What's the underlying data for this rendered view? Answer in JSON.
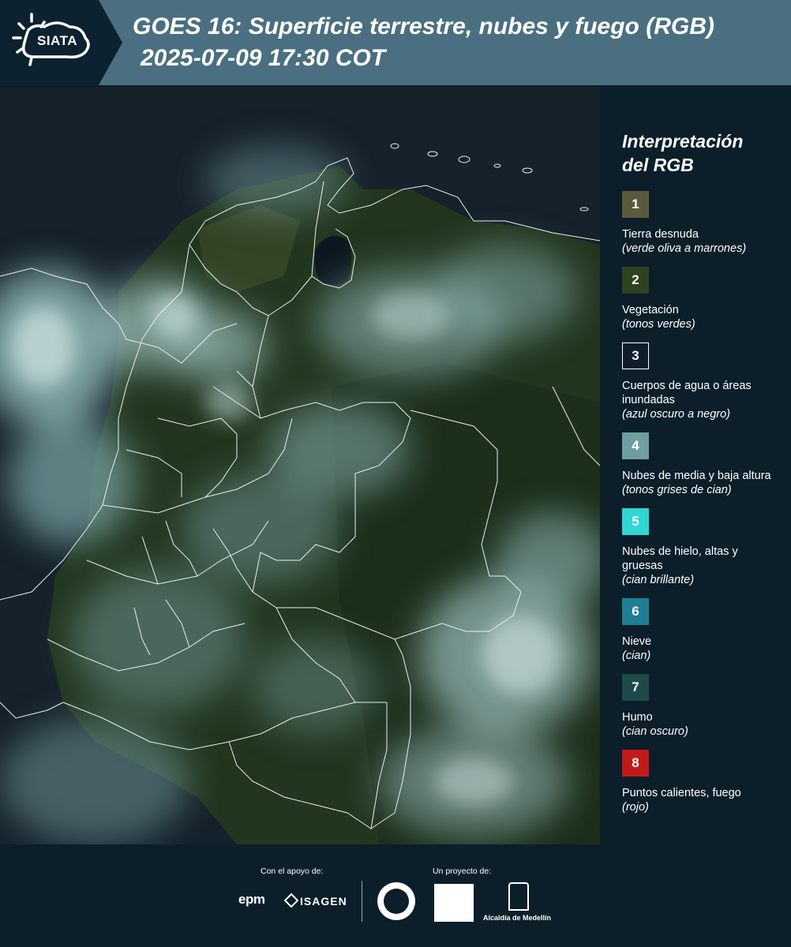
{
  "header": {
    "logo_text": "SIATA",
    "title_line1": "GOES 16: Superficie terrestre, nubes y fuego (RGB)",
    "title_line2": "2025-07-09 17:30 COT"
  },
  "legend": {
    "title_line1": "Interpretación",
    "title_line2": "del RGB",
    "items": [
      {
        "number": "1",
        "color": "#5c5a3c",
        "label": "Tierra desnuda",
        "sub": "(verde oliva a marrones)"
      },
      {
        "number": "2",
        "color": "#2e4220",
        "label": "Vegetación",
        "sub": "(tonos verdes)"
      },
      {
        "number": "3",
        "color": "#0b1e2a",
        "label": "Cuerpos de agua o áreas inundadas",
        "sub": "(azul oscuro a negro)"
      },
      {
        "number": "4",
        "color": "#6f9ea0",
        "label": "Nubes de media y baja altura",
        "sub": "(tonos grises de cian)"
      },
      {
        "number": "5",
        "color": "#2fd6d4",
        "label": "Nubes de hielo, altas y gruesas",
        "sub": "(cian brillante)"
      },
      {
        "number": "6",
        "color": "#1f7e92",
        "label": "Nieve",
        "sub": "(cian)"
      },
      {
        "number": "7",
        "color": "#1e4a4a",
        "label": "Humo",
        "sub": "(cian oscuro)"
      },
      {
        "number": "8",
        "color": "#c21a1a",
        "label": "Puntos calientes, fuego",
        "sub": "(rojo)"
      }
    ]
  },
  "footer": {
    "support_label": "Con el apoyo de:",
    "project_label": "Un proyecto de:",
    "support_logos": [
      "epm",
      "ISAGEN"
    ],
    "project_logos": [
      "Área Metropolitana Valle de Aburrá",
      "Alcaldía de Medellín"
    ],
    "epm_text": "epm",
    "isagen_text": "ISAGEN",
    "medellin_text": "Alcaldía de Medellín"
  },
  "colors": {
    "header_bg": "#4a6f80",
    "page_bg": "#0b1e2a",
    "ocean": "#14202a",
    "vegetation": "#23381f",
    "cloud": "#8fb2b2",
    "border": "#e8eef0"
  }
}
